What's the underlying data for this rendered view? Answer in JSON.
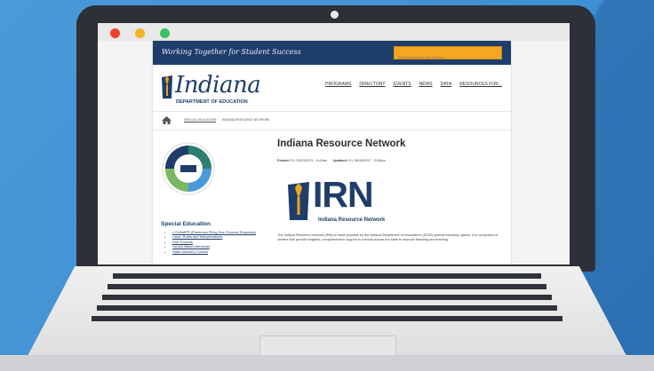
{
  "browser": {
    "window_controls": [
      "close",
      "minimize",
      "maximize"
    ]
  },
  "site": {
    "tagline": "Working Together for Student Success",
    "search_placeholder": "Enter search terms then hit return...",
    "logo": {
      "name": "Indiana",
      "dept": "DEPARTMENT OF EDUCATION"
    },
    "nav": [
      "PROGRAMS",
      "DIRECTORY",
      "EVENTS",
      "NEWS",
      "DATA",
      "RESOURCES FOR..."
    ],
    "breadcrumb": [
      "SPECIAL EDUCATION",
      "INDIANA RESOURCE NETWORK"
    ],
    "breadcrumb_separator": "›"
  },
  "sidebar": {
    "heading": "Special Education",
    "items": [
      "I-CHAMP® (Electronic Filing Due Process Requests)",
      "Laws, Rules and Interpretations",
      "Due Process",
      "School Based Medicaid",
      "State Advisory Council"
    ]
  },
  "article": {
    "title": "Indiana Resource Network",
    "posted_label": "Posted:",
    "posted_value": "Fri, 09/23/2011 - 9:41am",
    "updated_label": "Updated:",
    "updated_value": "Fri, 05/19/2017 - 2:59pm",
    "irn_letters": "IRN",
    "irn_sub": "Indiana Resource Network",
    "paragraph": "The Indiana Resource Network (IRN) is made possible by the Indiana Department of Education's (IDOE) special education grants. It is comprised of centers that provide targeted, comprehensive support to schools across the state to improve teaching and learning."
  },
  "colors": {
    "navy": "#1f3d6b",
    "search_orange": "#f5a623",
    "background_blue": "#3f8fd4",
    "laptop_dark": "#2d3137",
    "torch_gold": "#e9a51c"
  },
  "icons": [
    "home-icon",
    "torch-logo-icon",
    "circular-badge-icon"
  ]
}
